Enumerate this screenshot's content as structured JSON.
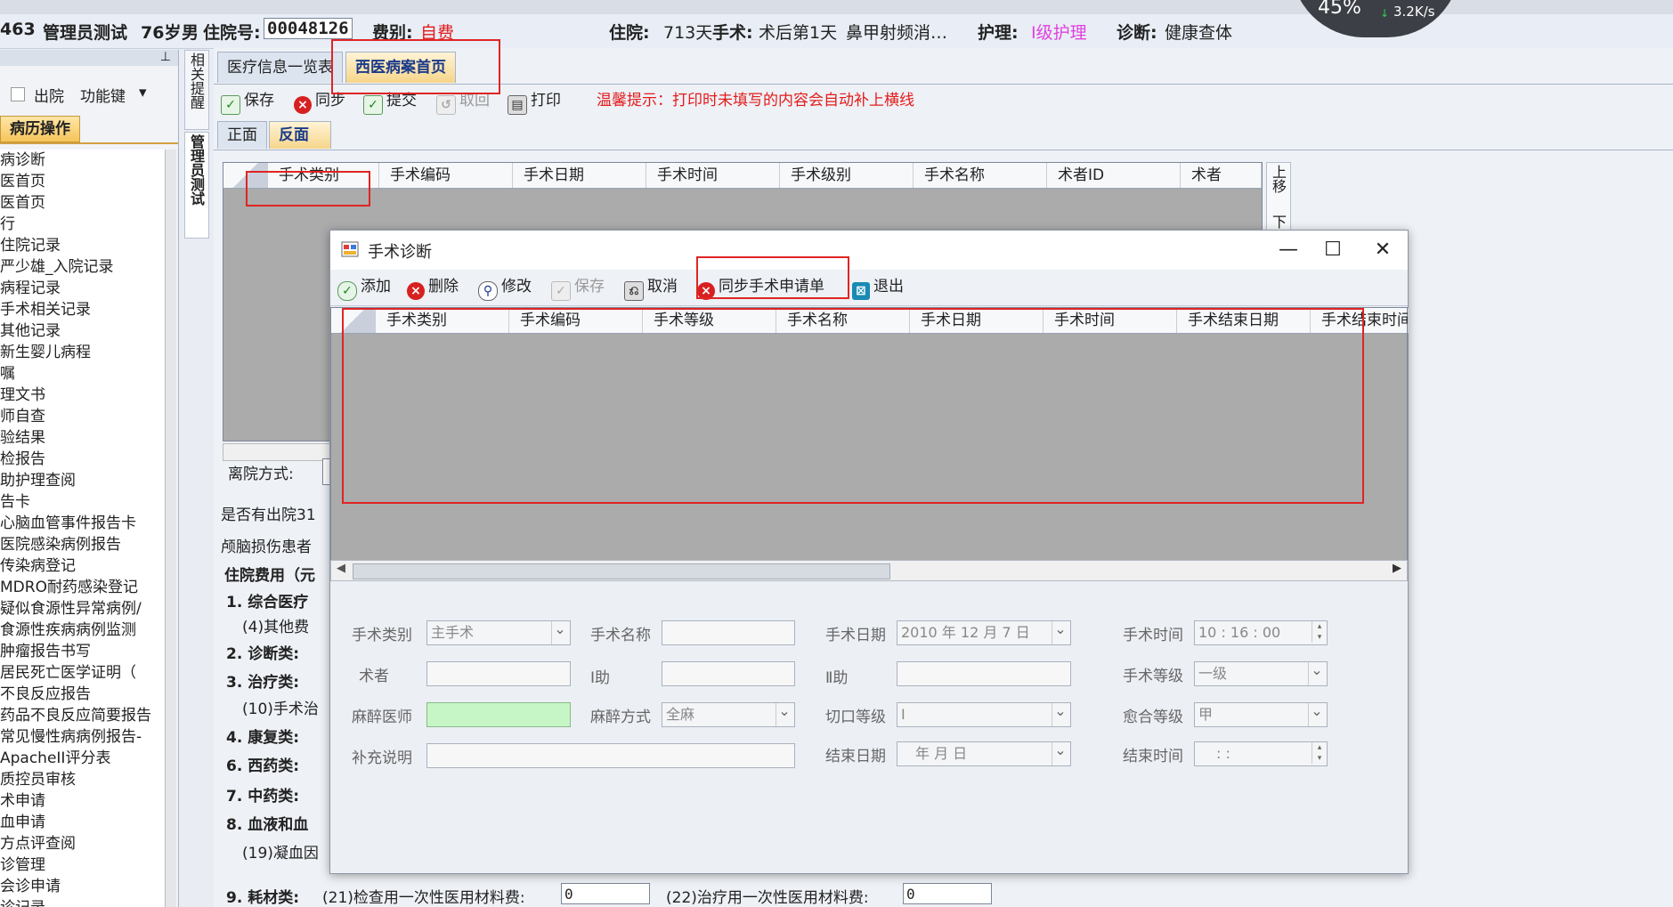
{
  "patient": {
    "id_fragment": "463",
    "name": "管理员测试",
    "age": "76岁",
    "sex": "男",
    "admission_label": "住院号:",
    "admission_no": "00048126",
    "fee_label": "费别:",
    "fee_type": "自费",
    "stay_label": "住院:",
    "stay_days": "713天",
    "surgery_label": "手术:",
    "surgery_status": "术后第1天",
    "surgery_name": "鼻甲射频消…",
    "nursing_label": "护理:",
    "nursing_level": "Ⅰ级护理",
    "diagnosis_label": "诊断:",
    "diagnosis": "健康查体"
  },
  "gauge": {
    "percent": "45%",
    "speed": "3.2K/s"
  },
  "left_panel": {
    "discharge_label": "出院",
    "function_keys_label": "功能键",
    "section_tab": "病历操作",
    "items": [
      "病诊断",
      "医首页",
      "医首页",
      "行",
      "住院记录",
      "严少雄_入院记录",
      "病程记录",
      "手术相关记录",
      "其他记录",
      "新生婴儿病程",
      "嘱",
      "理文书",
      "师自查",
      "验结果",
      "检报告",
      "助护理查阅",
      "告卡",
      "心脑血管事件报告卡",
      "医院感染病例报告",
      "传染病登记",
      "MDRO耐药感染登记",
      "疑似食源性异常病例/",
      "食源性疾病病例监测",
      "肿瘤报告书写",
      "居民死亡医学证明（",
      "不良反应报告",
      "药品不良反应简要报告",
      "常见慢性病病例报告-",
      "ApacheII评分表",
      "质控员审核",
      "术申请",
      "血申请",
      "方点评查阅",
      "诊管理",
      "会诊申请",
      "诊记录"
    ]
  },
  "vertical_tabs": {
    "reminder": "相关提醒",
    "admin": "管理员测试"
  },
  "main": {
    "tabs": [
      "医疗信息一览表",
      "西医病案首页"
    ],
    "toolbar": {
      "save": "保存",
      "sync": "同步",
      "submit": "提交",
      "cancel": "取回",
      "print": "打印",
      "tip": "温馨提示：打印时未填写的内容会自动补上横线"
    },
    "subtabs": [
      "正面",
      "反面"
    ],
    "grid_columns": [
      "手术类别",
      "手术编码",
      "手术日期",
      "手术时间",
      "手术级别",
      "手术名称",
      "术者ID",
      "术者"
    ],
    "side_buttons": {
      "up": "上移",
      "down": "下"
    },
    "form": {
      "discharge_mode": "离院方式:",
      "readmit": "是否有出院31",
      "brain_injury": "颅脑损伤患者",
      "fees_title": "住院费用（元",
      "fee1": "1. 综合医疗",
      "fee1_sub": "(4)其他费",
      "fee2": "2. 诊断类:",
      "fee3": "3. 治疗类:",
      "fee3_sub": "(10)手术治",
      "fee4": "4. 康复类:",
      "fee6": "6. 西药类:",
      "fee7": "7. 中药类:",
      "fee8": "8. 血液和血",
      "fee8_sub": "(19)凝血因",
      "fee9": "9. 耗材类:",
      "fee9_a": "(21)检查用一次性医用材料费:",
      "fee9_a_val": "0",
      "fee9_b": "(22)治疗用一次性医用材料费:",
      "fee9_b_val": "0"
    }
  },
  "dialog": {
    "title": "手术诊断",
    "toolbar": {
      "add": "添加",
      "delete": "删除",
      "edit": "修改",
      "save": "保存",
      "cancel": "取消",
      "sync_request": "同步手术申请单",
      "exit": "退出"
    },
    "grid_columns": [
      "手术类别",
      "手术编码",
      "手术等级",
      "手术名称",
      "手术日期",
      "手术时间",
      "手术结束日期",
      "手术结束时间"
    ],
    "form": {
      "surgery_type_label": "手术类别",
      "surgery_type_value": "主手术",
      "surgery_name_label": "手术名称",
      "surgery_date_label": "手术日期",
      "surgery_date_value": "2010 年 12 月 7 日",
      "surgery_time_label": "手术时间",
      "surgery_time_value": "10 : 16 : 00",
      "surgeon_label": "术者",
      "assistant1_label": "Ⅰ助",
      "assistant2_label": "Ⅱ助",
      "surgery_level_label": "手术等级",
      "surgery_level_value": "一级",
      "anesthetist_label": "麻醉医师",
      "anesthesia_method_label": "麻醉方式",
      "anesthesia_method_value": "全麻",
      "incision_label": "切口等级",
      "incision_value": "Ⅰ",
      "healing_label": "愈合等级",
      "healing_value": "甲",
      "supplement_label": "补充说明",
      "end_date_label": "结束日期",
      "end_date_value": "年   月   日",
      "end_time_label": "结束时间",
      "end_time_value": ":   :"
    }
  },
  "colors": {
    "annotation_red": "#e02424",
    "tab_active": "#f6d58a",
    "grid_gray": "#ababab",
    "tip_red": "#e31b1b"
  }
}
